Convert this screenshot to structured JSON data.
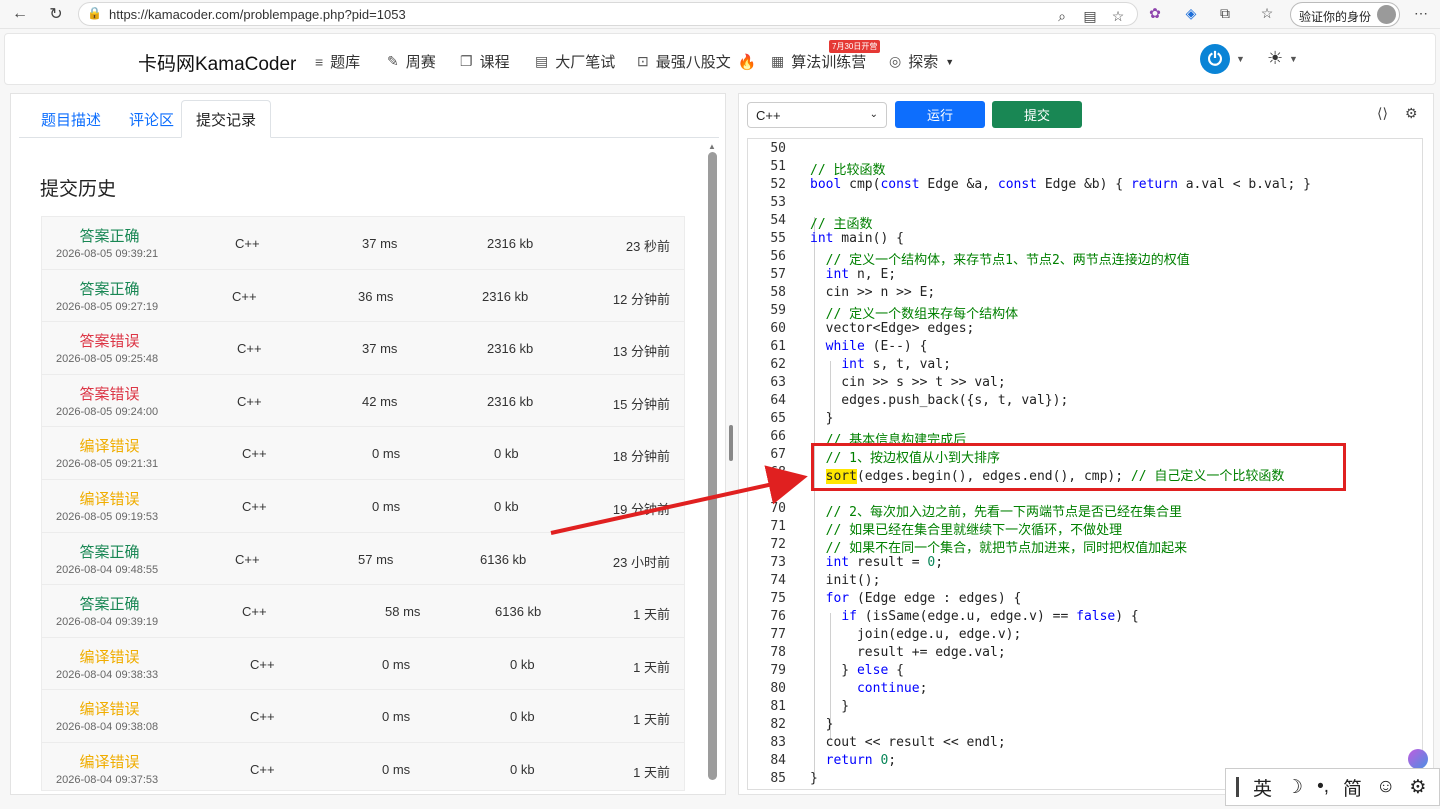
{
  "browser": {
    "url": "https://kamacoder.com/problempage.php?pid=1053",
    "verify_label": "验证你的身份"
  },
  "site": {
    "brand": "卡码网KamaCoder",
    "nav": [
      "题库",
      "周赛",
      "课程",
      "大厂笔试",
      "最强八股文",
      "算法训练营",
      "探索"
    ],
    "badge": "7月30日开营",
    "fire_emoji": "🔥"
  },
  "left": {
    "tabs": [
      "题目描述",
      "评论区",
      "提交记录"
    ],
    "active_tab": "提交记录",
    "history_title": "提交历史",
    "rows": [
      {
        "status": "答案正确",
        "kind": "ok",
        "time": "2026-08-05 09:39:21",
        "lang": "C++",
        "runtime": "37 ms",
        "memory": "2316 kb",
        "ago": "23 秒前"
      },
      {
        "status": "答案正确",
        "kind": "ok",
        "time": "2026-08-05 09:27:19",
        "lang": "C++",
        "runtime": "36 ms",
        "memory": "2316 kb",
        "ago": "12 分钟前"
      },
      {
        "status": "答案错误",
        "kind": "wa",
        "time": "2026-08-05 09:25:48",
        "lang": "C++",
        "runtime": "37 ms",
        "memory": "2316 kb",
        "ago": "13 分钟前"
      },
      {
        "status": "答案错误",
        "kind": "wa",
        "time": "2026-08-05 09:24:00",
        "lang": "C++",
        "runtime": "42 ms",
        "memory": "2316 kb",
        "ago": "15 分钟前"
      },
      {
        "status": "编译错误",
        "kind": "ce",
        "time": "2026-08-05 09:21:31",
        "lang": "C++",
        "runtime": "0 ms",
        "memory": "0 kb",
        "ago": "18 分钟前"
      },
      {
        "status": "编译错误",
        "kind": "ce",
        "time": "2026-08-05 09:19:53",
        "lang": "C++",
        "runtime": "0 ms",
        "memory": "0 kb",
        "ago": "19 分钟前"
      },
      {
        "status": "答案正确",
        "kind": "ok",
        "time": "2026-08-04 09:48:55",
        "lang": "C++",
        "runtime": "57 ms",
        "memory": "6136 kb",
        "ago": "23 小时前"
      },
      {
        "status": "答案正确",
        "kind": "ok",
        "time": "2026-08-04 09:39:19",
        "lang": "C++",
        "runtime": "58 ms",
        "memory": "6136 kb",
        "ago": "1 天前"
      },
      {
        "status": "编译错误",
        "kind": "ce",
        "time": "2026-08-04 09:38:33",
        "lang": "C++",
        "runtime": "0 ms",
        "memory": "0 kb",
        "ago": "1 天前"
      },
      {
        "status": "编译错误",
        "kind": "ce",
        "time": "2026-08-04 09:38:08",
        "lang": "C++",
        "runtime": "0 ms",
        "memory": "0 kb",
        "ago": "1 天前"
      },
      {
        "status": "编译错误",
        "kind": "ce",
        "time": "2026-08-04 09:37:53",
        "lang": "C++",
        "runtime": "0 ms",
        "memory": "0 kb",
        "ago": "1 天前"
      }
    ],
    "status_colors": {
      "ok": "#198754",
      "wa": "#dc3545",
      "ce": "#f0ad00"
    }
  },
  "editor": {
    "language": "C++",
    "run_label": "运行",
    "submit_label": "提交",
    "lines": [
      {
        "n": "50",
        "t": ""
      },
      {
        "n": "51",
        "t": "// 比较函数"
      },
      {
        "n": "52",
        "t": "bool cmp(const Edge &a, const Edge &b) { return a.val < b.val; }"
      },
      {
        "n": "53",
        "t": ""
      },
      {
        "n": "54",
        "t": "// 主函数"
      },
      {
        "n": "55",
        "t": "int main() {"
      },
      {
        "n": "56",
        "t": "  // 定义一个结构体，来存节点1、节点2、两节点连接边的权值"
      },
      {
        "n": "57",
        "t": "  int n, E;"
      },
      {
        "n": "58",
        "t": "  cin >> n >> E;"
      },
      {
        "n": "59",
        "t": "  // 定义一个数组来存每个结构体"
      },
      {
        "n": "60",
        "t": "  vector<Edge> edges;"
      },
      {
        "n": "61",
        "t": "  while (E--) {"
      },
      {
        "n": "62",
        "t": "    int s, t, val;"
      },
      {
        "n": "63",
        "t": "    cin >> s >> t >> val;"
      },
      {
        "n": "64",
        "t": "    edges.push_back({s, t, val});"
      },
      {
        "n": "65",
        "t": "  }"
      },
      {
        "n": "66",
        "t": "  // 基本信息构建完成后"
      },
      {
        "n": "67",
        "t": "  // 1、按边权值从小到大排序"
      },
      {
        "n": "68",
        "t": "  sort(edges.begin(), edges.end(), cmp); // 自己定义一个比较函数"
      },
      {
        "n": "69",
        "t": ""
      },
      {
        "n": "70",
        "t": "  // 2、每次加入边之前，先看一下两端节点是否已经在集合里"
      },
      {
        "n": "71",
        "t": "  // 如果已经在集合里就继续下一次循环，不做处理"
      },
      {
        "n": "72",
        "t": "  // 如果不在同一个集合，就把节点加进来，同时把权值加起来"
      },
      {
        "n": "73",
        "t": "  int result = 0;"
      },
      {
        "n": "74",
        "t": "  init();"
      },
      {
        "n": "75",
        "t": "  for (Edge edge : edges) {"
      },
      {
        "n": "76",
        "t": "    if (isSame(edge.u, edge.v) == false) {"
      },
      {
        "n": "77",
        "t": "      join(edge.u, edge.v);"
      },
      {
        "n": "78",
        "t": "      result += edge.val;"
      },
      {
        "n": "79",
        "t": "    } else {"
      },
      {
        "n": "80",
        "t": "      continue;"
      },
      {
        "n": "81",
        "t": "    }"
      },
      {
        "n": "82",
        "t": "  }"
      },
      {
        "n": "83",
        "t": "  cout << result << endl;"
      },
      {
        "n": "84",
        "t": "  return 0;"
      },
      {
        "n": "85",
        "t": "}"
      }
    ]
  },
  "ime": [
    "英",
    "☽",
    "•,",
    "简",
    "☺",
    "⚙"
  ]
}
